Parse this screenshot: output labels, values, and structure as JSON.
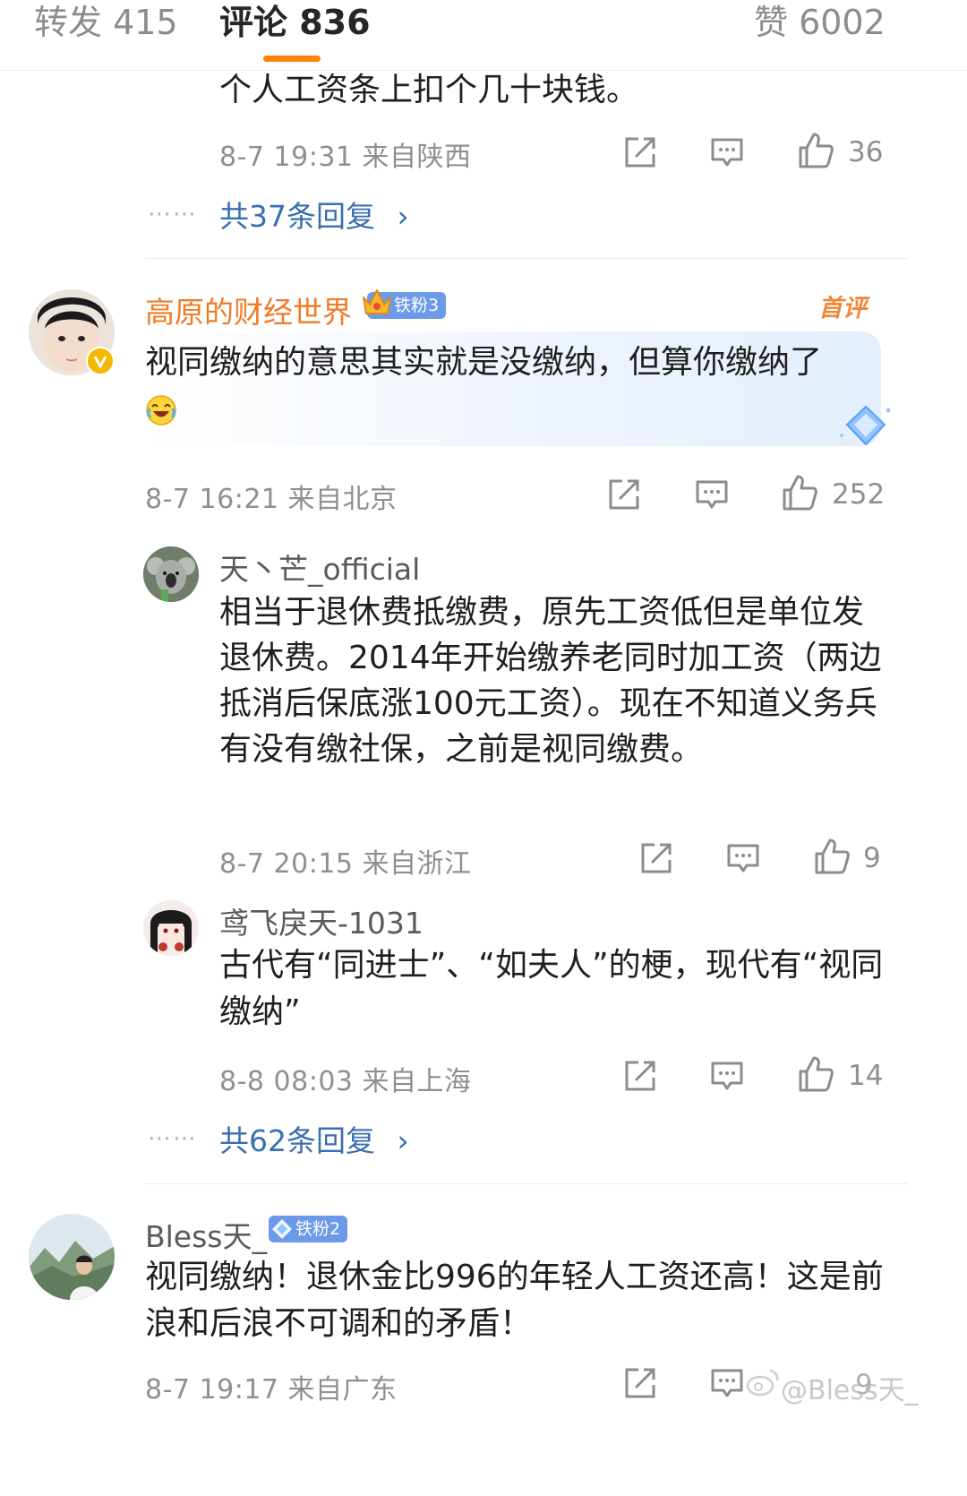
{
  "tabs": {
    "repost_label": "转发 415",
    "comments_label": "评论 836",
    "likes_label": "赞 6002"
  },
  "comment0": {
    "text": "个人工资条上扣个几十块钱。",
    "meta": "8-7 19:31  来自陕西",
    "like_count": "36",
    "replies_link": "共37条回复",
    "chevron": "›"
  },
  "comment1": {
    "username": "高原的财经世界",
    "badge": "铁粉3",
    "first_tag": "首评",
    "text": "视同缴纳的意思其实就是没缴纳，但算你缴纳了",
    "meta": "8-7 16:21  来自北京",
    "like_count": "252",
    "replies": [
      {
        "username": "天丶芒_official",
        "text": "相当于退休费抵缴费，原先工资低但是单位发退休费。2014年开始缴养老同时加工资（两边抵消后保底涨100元工资）。现在不知道义务兵有没有缴社保，之前是视同缴费。",
        "meta": "8-7 20:15  来自浙江",
        "like_count": "9"
      },
      {
        "username": "鸢飞戾天-1031",
        "text": "古代有“同进士”、“如夫人”的梗，现代有“视同缴纳”",
        "meta": "8-8 08:03  来自上海",
        "like_count": "14"
      }
    ],
    "replies_link": "共62条回复",
    "chevron": "›"
  },
  "comment2": {
    "username": "Bless天_",
    "badge": "铁粉2",
    "text": "视同缴纳！退休金比996的年轻人工资还高！这是前浪和后浪不可调和的矛盾！",
    "meta": "8-7 19:17  来自广东",
    "watermark": "@Bless天_",
    "like_count_partial": "9"
  },
  "colors": {
    "accent_orange": "#ff8200",
    "link_blue": "#3a6fb0",
    "username_orange": "#ef7b26",
    "meta_gray": "#8f8f8f"
  },
  "icons": [
    "share-icon",
    "comment-icon",
    "thumbs-up-icon",
    "verified-v-icon",
    "crown-badge-icon",
    "diamond-badge-icon",
    "laughing-emoji-icon",
    "weibo-logo-icon"
  ]
}
